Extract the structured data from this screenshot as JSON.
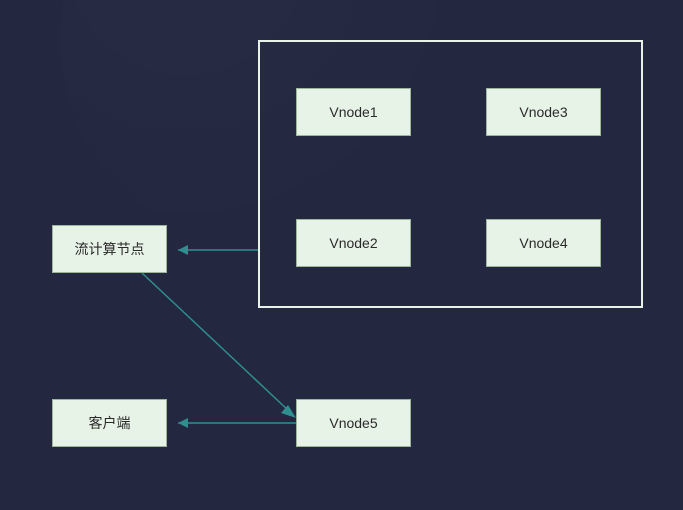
{
  "nodes": {
    "stream_compute": "流计算节点",
    "client": "客户端",
    "vnode1": "Vnode1",
    "vnode2": "Vnode2",
    "vnode3": "Vnode3",
    "vnode4": "Vnode4",
    "vnode5": "Vnode5"
  },
  "edges": [
    {
      "from": "vnode-group",
      "to": "stream-compute-node"
    },
    {
      "from": "stream-compute-node",
      "to": "vnode5-node"
    },
    {
      "from": "vnode5-node",
      "to": "client-node"
    }
  ]
}
